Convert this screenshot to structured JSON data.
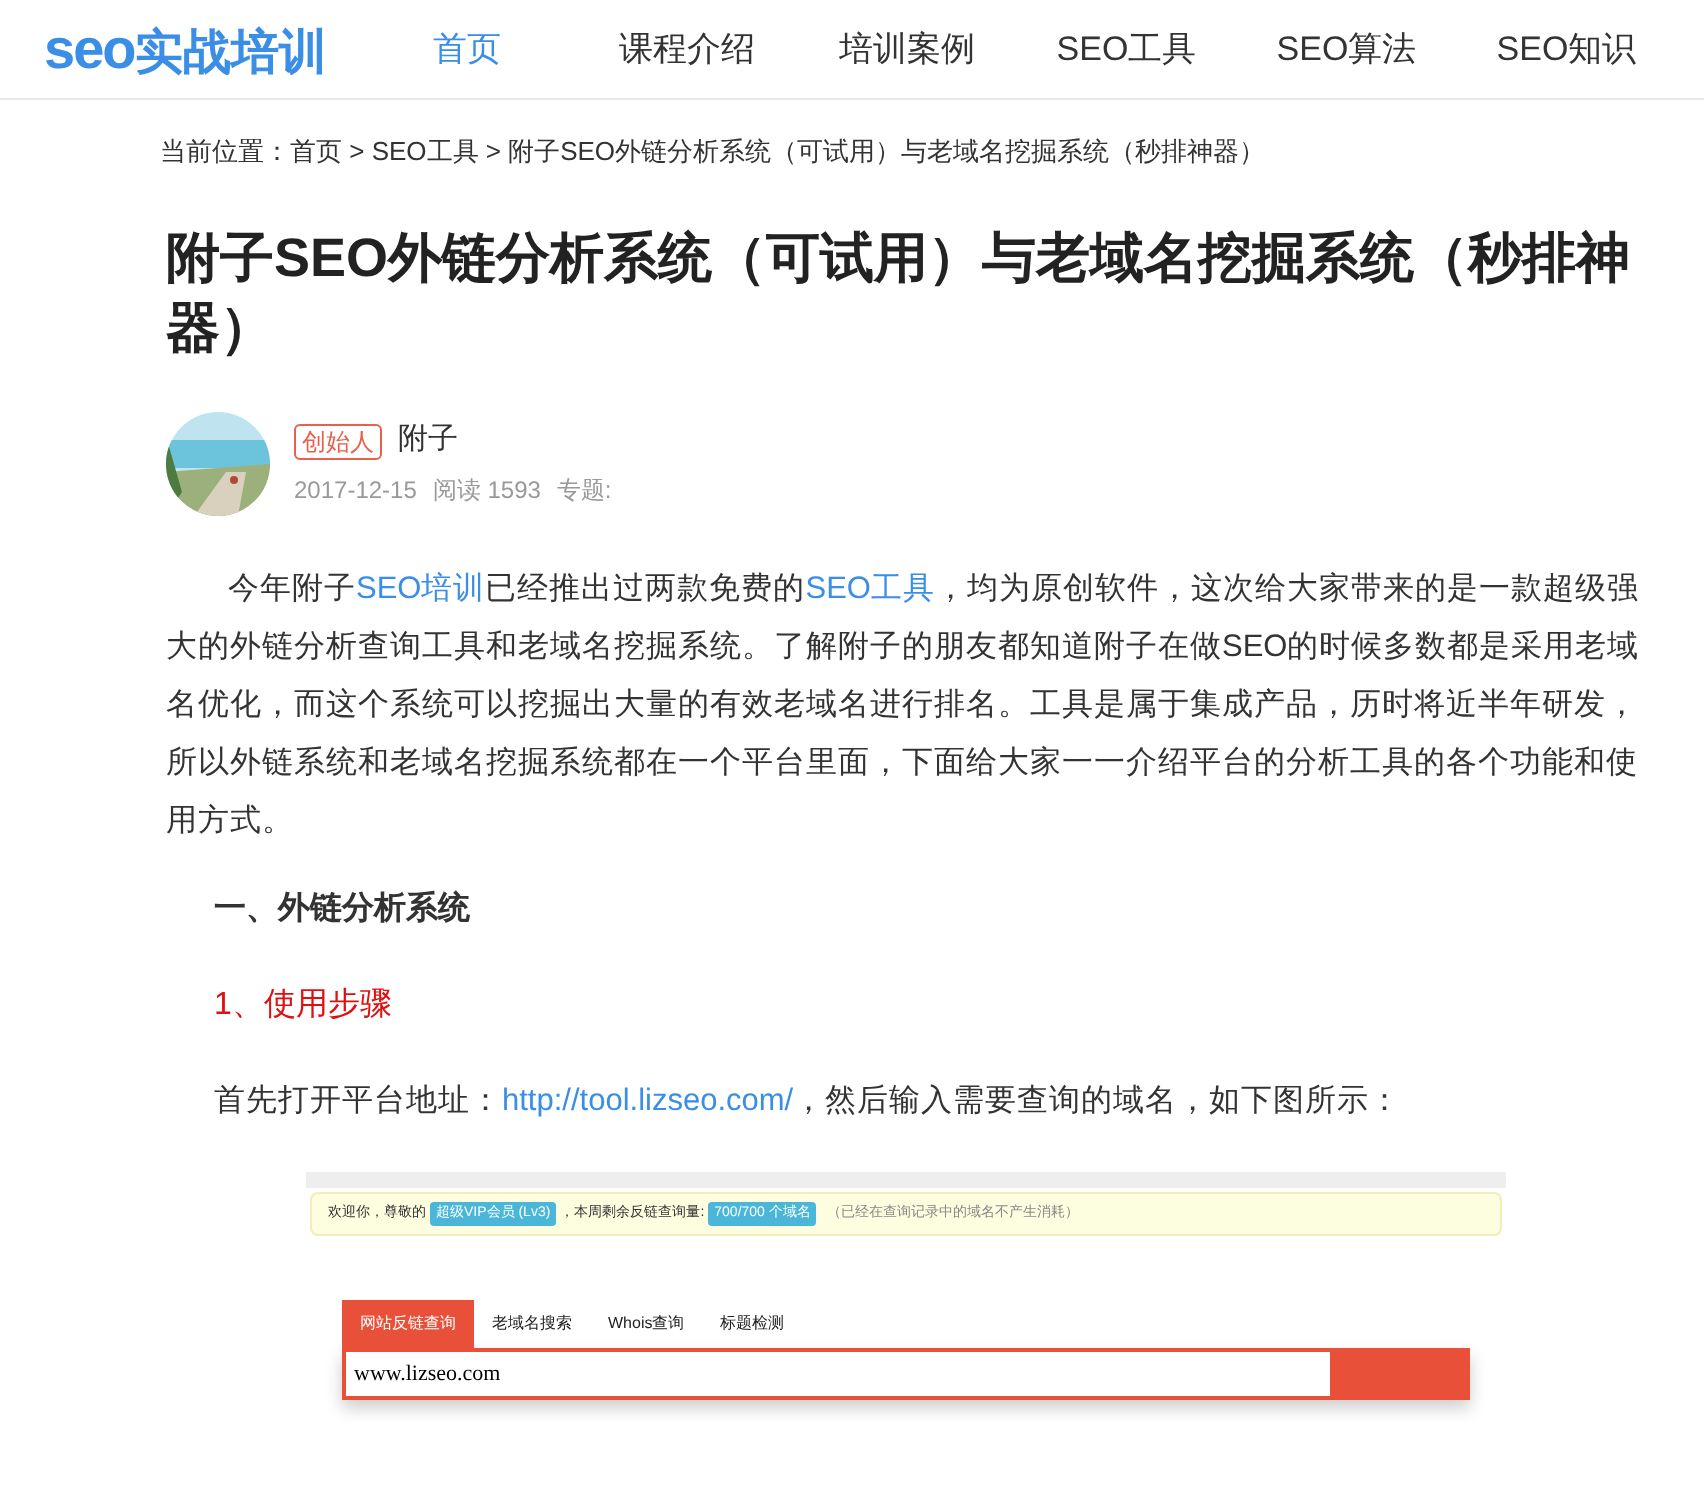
{
  "logo": {
    "latin": "seo",
    "chinese": "实战培训"
  },
  "nav": [
    {
      "label": "首页",
      "selected": true
    },
    {
      "label": "课程介绍",
      "selected": false
    },
    {
      "label": "培训案例",
      "selected": false
    },
    {
      "label": "SEO工具",
      "selected": false
    },
    {
      "label": "SEO算法",
      "selected": false
    },
    {
      "label": "SEO知识",
      "selected": false
    }
  ],
  "breadcrumb": "当前位置：首页 > SEO工具 > 附子SEO外链分析系统（可试用）与老域名挖掘系统（秒排神器）",
  "title": "附子SEO外链分析系统（可试用）与老域名挖掘系统（秒排神器）",
  "author": {
    "badge": "创始人",
    "name": "附子",
    "date": "2017-12-15",
    "reads": "阅读 1593",
    "topic": "专题:"
  },
  "intro": [
    {
      "kind": "text",
      "text": "今年附子"
    },
    {
      "kind": "link",
      "text": "SEO培训"
    },
    {
      "kind": "text",
      "text": "已经推出过两款免费的"
    },
    {
      "kind": "link",
      "text": "SEO工具"
    },
    {
      "kind": "text",
      "text": "，均为原创软件，这次给大家带来的是一款超级强大的外链分析查询工具和老域名挖掘系统。了解附子的朋友都知道附子在做SEO的时候多数都是采用老域名优化，而这个系统可以挖掘出大量的有效老域名进行排名。工具是属于集成产品，历时将近半年研发，所以外链系统和老域名挖掘系统都在一个平台里面，下面给大家一一介绍平台的分析工具的各个功能和使用方式。"
    }
  ],
  "section_heading": "一、外链分析系统",
  "step_heading": "1、使用步骤",
  "step_text": [
    {
      "kind": "text",
      "text": "首先打开平台地址："
    },
    {
      "kind": "link",
      "text": "http://tool.lizseo.com/"
    },
    {
      "kind": "text",
      "text": "，然后输入需要查询的域名，如下图所示："
    }
  ],
  "screenshot": {
    "notice": [
      {
        "kind": "text",
        "text": "欢迎你，尊敬的"
      },
      {
        "kind": "tag",
        "text": "超级VIP会员 (Lv3)"
      },
      {
        "kind": "text",
        "text": "，本周剩余反链查询量:"
      },
      {
        "kind": "tag",
        "text": "700/700 个域名"
      },
      {
        "kind": "note",
        "text": "（已经在查询记录中的域名不产生消耗）"
      }
    ],
    "tabs": [
      {
        "label": "网站反链查询",
        "selected": true
      },
      {
        "label": "老域名搜索",
        "selected": false
      },
      {
        "label": "Whois查询",
        "selected": false
      },
      {
        "label": "标题检测",
        "selected": false
      }
    ],
    "query_value": "www.lizseo.com"
  }
}
